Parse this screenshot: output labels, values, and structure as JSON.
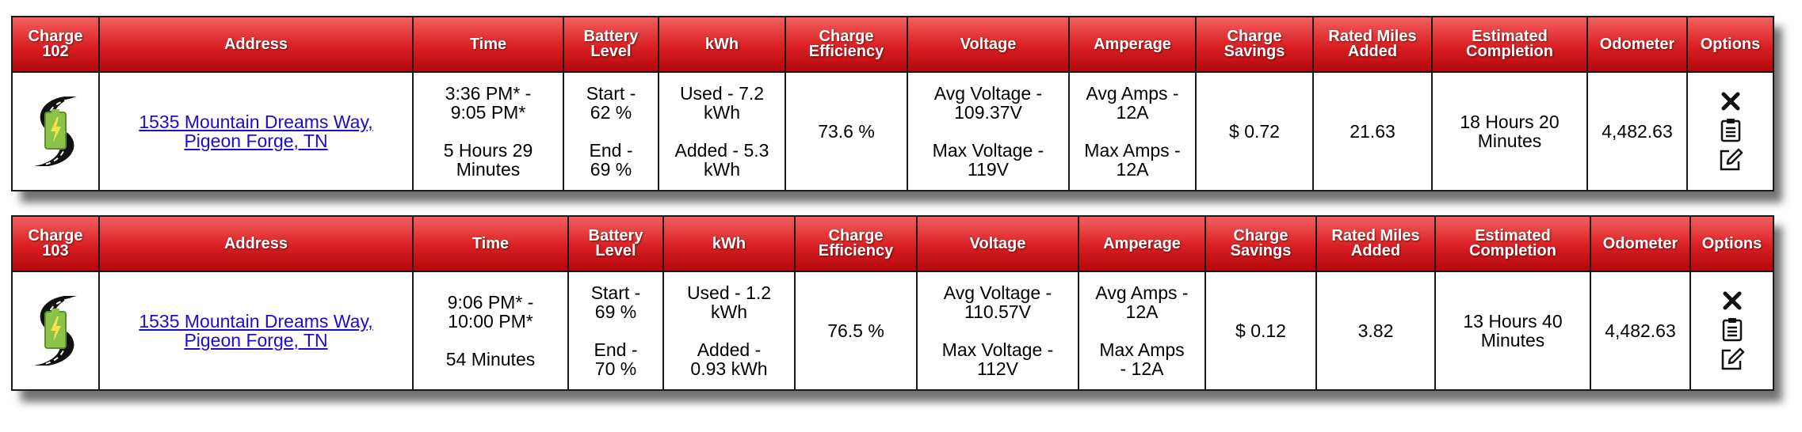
{
  "columns": {
    "address": "Address",
    "time": "Time",
    "battery": [
      "Battery",
      "Level"
    ],
    "kwh": "kWh",
    "efficiency": [
      "Charge",
      "Efficiency"
    ],
    "voltage": "Voltage",
    "amperage": "Amperage",
    "savings": [
      "Charge",
      "Savings"
    ],
    "rated": [
      "Rated Miles",
      "Added"
    ],
    "completion": [
      "Estimated",
      "Completion"
    ],
    "odometer": "Odometer",
    "options": "Options"
  },
  "charges": [
    {
      "label": [
        "Charge",
        "102"
      ],
      "address": [
        "1535 Mountain Dreams Way,",
        "Pigeon Forge, TN"
      ],
      "time_range": [
        "3:36 PM* -",
        "9:05 PM*"
      ],
      "duration": [
        "5 Hours 29",
        "Minutes"
      ],
      "battery_start": [
        "Start -",
        "62 %"
      ],
      "battery_end": [
        "End -",
        "69 %"
      ],
      "kwh_used": [
        "Used - 7.2",
        "kWh"
      ],
      "kwh_added": [
        "Added - 5.3",
        "kWh"
      ],
      "efficiency": "73.6 %",
      "avg_voltage": [
        "Avg Voltage -",
        "109.37V"
      ],
      "max_voltage": [
        "Max Voltage -",
        "119V"
      ],
      "avg_amps": [
        "Avg Amps -",
        "12A"
      ],
      "max_amps": [
        "Max Amps -",
        "12A"
      ],
      "savings": "$ 0.72",
      "rated_miles": "21.63",
      "completion": [
        "18 Hours 20",
        "Minutes"
      ],
      "odometer": "4,482.63"
    },
    {
      "label": [
        "Charge",
        "103"
      ],
      "address": [
        "1535 Mountain Dreams Way,",
        "Pigeon Forge, TN"
      ],
      "time_range": [
        "9:06 PM* -",
        "10:00 PM*"
      ],
      "duration": [
        "54 Minutes"
      ],
      "battery_start": [
        "Start -",
        "69 %"
      ],
      "battery_end": [
        "End -",
        "70 %"
      ],
      "kwh_used": [
        "Used - 1.2",
        "kWh"
      ],
      "kwh_added": [
        "Added -",
        "0.93 kWh"
      ],
      "efficiency": "76.5 %",
      "avg_voltage": [
        "Avg Voltage -",
        "110.57V"
      ],
      "max_voltage": [
        "Max Voltage -",
        "112V"
      ],
      "avg_amps": [
        "Avg Amps -",
        "12A"
      ],
      "max_amps": [
        "Max Amps",
        "- 12A"
      ],
      "savings": "$ 0.12",
      "rated_miles": "3.82",
      "completion": [
        "13 Hours 40",
        "Minutes"
      ],
      "odometer": "4,482.63"
    }
  ],
  "icons": {
    "charge": "road-battery-icon",
    "delete": "close-icon",
    "notes": "clipboard-icon",
    "edit": "edit-icon"
  },
  "colors": {
    "header_top": "#f26060",
    "header_bottom": "#b3080c",
    "link": "#1a0dcc",
    "battery_green": "#8bc34a"
  }
}
